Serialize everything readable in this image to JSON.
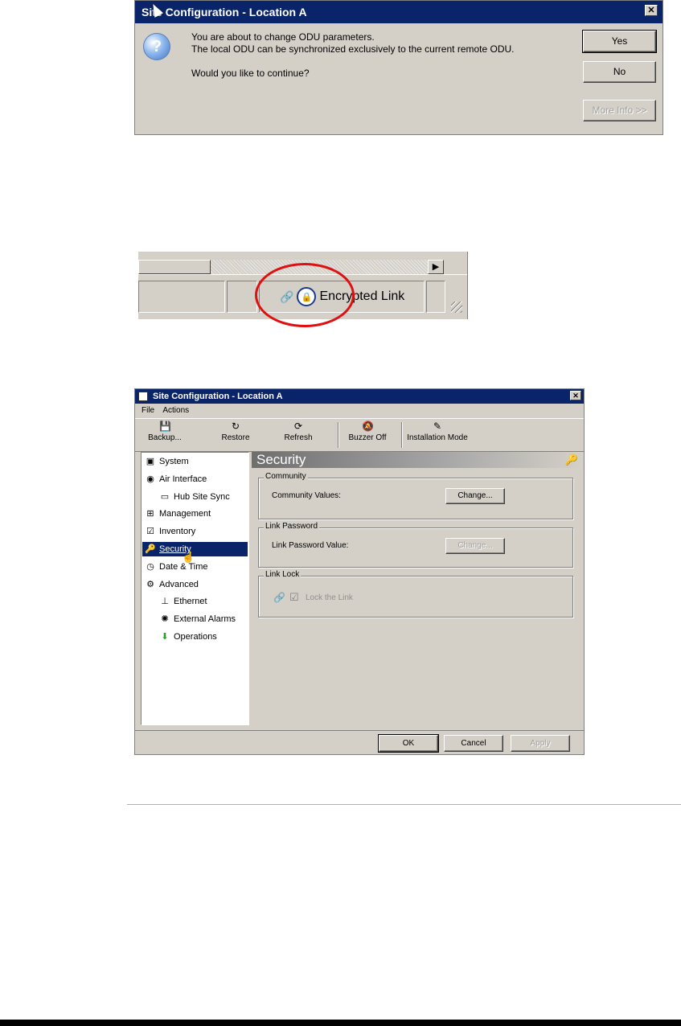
{
  "dialog1": {
    "title": "Site Configuration - Location A",
    "close_glyph": "✕",
    "question_glyph": "?",
    "line1": "You are about to change ODU parameters.",
    "line2": "The local ODU can be synchronized exclusively to the current remote ODU.",
    "line3": "Would you like to continue?",
    "yes_label": "Yes",
    "no_label": "No",
    "more_info_label": "More Info >>"
  },
  "statusbar": {
    "arrow_glyph": "▶",
    "link_glyph": "🔗",
    "lock_glyph": "🔒",
    "encrypted_label": "Encrypted Link"
  },
  "dialog2": {
    "title": "Site Configuration - Location A",
    "close_glyph": "✕",
    "menu": [
      "File",
      "Actions"
    ],
    "toolbar": [
      {
        "label": "Backup...",
        "icon": "💾"
      },
      {
        "label": "Restore",
        "icon": "↻"
      },
      {
        "label": "Refresh",
        "icon": "⟳"
      },
      {
        "label": "Buzzer Off",
        "icon": "🔕"
      },
      {
        "label": "Installation Mode",
        "icon": "✎"
      }
    ],
    "tree": [
      {
        "label": "System",
        "icon": "▣"
      },
      {
        "label": "Air Interface",
        "icon": "◉"
      },
      {
        "label": "Hub Site Sync",
        "icon": "▭"
      },
      {
        "label": "Management",
        "icon": "⊞"
      },
      {
        "label": "Inventory",
        "icon": "☑"
      },
      {
        "label": "Security",
        "icon": "🔑"
      },
      {
        "label": "Date & Time",
        "icon": "◷"
      },
      {
        "label": "Advanced",
        "icon": "⚙"
      },
      {
        "label": "Ethernet",
        "icon": "⊥"
      },
      {
        "label": "External Alarms",
        "icon": "✺"
      },
      {
        "label": "Operations",
        "icon": "⬇"
      }
    ],
    "panel_title": "Security",
    "panel_key_glyph": "🔑",
    "community": {
      "legend": "Community",
      "label": "Community Values:",
      "button": "Change..."
    },
    "link_password": {
      "legend": "Link Password",
      "label": "Link Password Value:",
      "button": "Change..."
    },
    "link_lock": {
      "legend": "Link Lock",
      "check_glyph": "☑",
      "label": "Lock the Link",
      "link_glyph": "🔗"
    },
    "ok_label": "OK",
    "cancel_label": "Cancel",
    "apply_label": "Apply"
  }
}
